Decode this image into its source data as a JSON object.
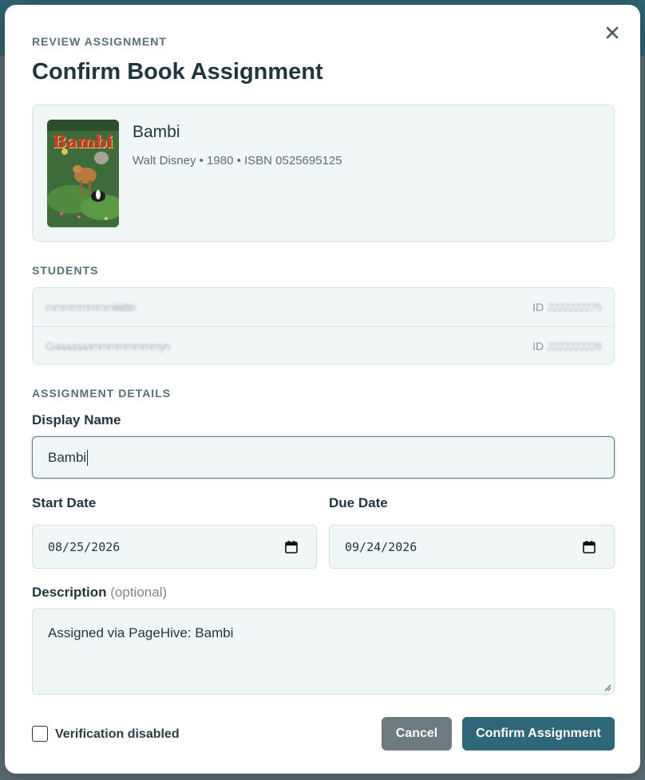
{
  "modal": {
    "eyebrow": "REVIEW ASSIGNMENT",
    "title": "Confirm Book Assignment",
    "close_icon": "close-icon"
  },
  "book": {
    "title": "Bambi",
    "meta": "Walt Disney • 1980 • ISBN 0525695125",
    "cover_text": "Bambi"
  },
  "students": {
    "label": "STUDENTS",
    "rows": [
      {
        "name": "mmmmmmmmiiiiiiitte",
        "id_label": "ID",
        "id_value": "2222222275"
      },
      {
        "name": "Gaaaaaaammmmmmmmyn",
        "id_label": "ID",
        "id_value": "2222222228"
      }
    ]
  },
  "details": {
    "label": "ASSIGNMENT DETAILS",
    "display_name_label": "Display Name",
    "display_name_value": "Bambi",
    "start_date_label": "Start Date",
    "start_date_value": "08/25/2026",
    "due_date_label": "Due Date",
    "due_date_value": "09/24/2026",
    "description_label": "Description",
    "description_optional": "(optional)",
    "description_value": "Assigned via PageHive: Bambi"
  },
  "footer": {
    "verification_label": "Verification disabled",
    "verification_checked": false,
    "cancel_label": "Cancel",
    "confirm_label": "Confirm Assignment"
  },
  "colors": {
    "primary": "#2e6878",
    "secondary": "#6c7b80",
    "heading": "#1f3640",
    "panel_bg": "#f1f6f6"
  }
}
